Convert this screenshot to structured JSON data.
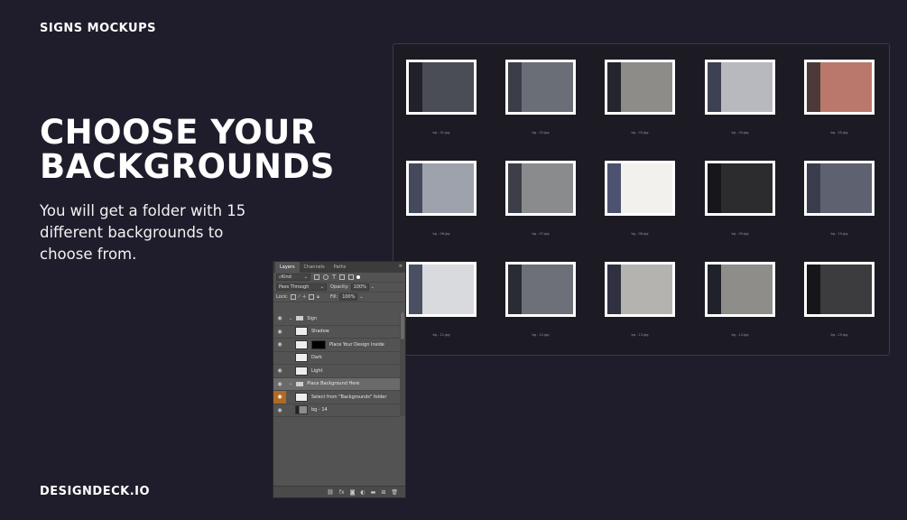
{
  "brand_top": "SIGNS MOCKUPS",
  "headline_line1": "CHOOSE YOUR",
  "headline_line2": "BACKGROUNDS",
  "subtext": "You will get a folder with 15 different backgrounds to choose from.",
  "brand_bottom": "DESIGNDECK.IO",
  "folder": {
    "files": [
      {
        "name": "bg - 01.jpg",
        "color": "#4a4d55",
        "stripe": "#20212b"
      },
      {
        "name": "bg - 02.jpg",
        "color": "#6a6e76",
        "stripe": "#3b3e48"
      },
      {
        "name": "bg - 03.jpg",
        "color": "#8e8c88",
        "stripe": "#25252d"
      },
      {
        "name": "bg - 04.jpg",
        "color": "#b7b9bf",
        "stripe": "#3d4152"
      },
      {
        "name": "bg - 05.jpg",
        "color": "#b9786b",
        "stripe": "#4c3a3a"
      },
      {
        "name": "bg - 06.jpg",
        "color": "#9ea2ac",
        "stripe": "#444a5c"
      },
      {
        "name": "bg - 07.jpg",
        "color": "#8a8b8c",
        "stripe": "#3d3f48"
      },
      {
        "name": "bg - 08.jpg",
        "color": "#f3f1ee",
        "stripe": "#4d5270"
      },
      {
        "name": "bg - 09.jpg",
        "color": "#2c2c2e",
        "stripe": "#16161c"
      },
      {
        "name": "bg - 10.jpg",
        "color": "#5e6170",
        "stripe": "#3a3d4d"
      },
      {
        "name": "bg - 11.jpg",
        "color": "#d9dadd",
        "stripe": "#4a5062"
      },
      {
        "name": "bg - 12.jpg",
        "color": "#6d7079",
        "stripe": "#2a2c34"
      },
      {
        "name": "bg - 13.jpg",
        "color": "#b5b3af",
        "stripe": "#2f3140"
      },
      {
        "name": "bg - 14.jpg",
        "color": "#8f8d8a",
        "stripe": "#20222b"
      },
      {
        "name": "bg - 15.jpg",
        "color": "#3c3c3e",
        "stripe": "#16161a"
      }
    ]
  },
  "photoshop": {
    "tabs": [
      "Layers",
      "Channels",
      "Paths"
    ],
    "filter_kind": "Kind",
    "blend_mode": "Pass Through",
    "opacity_label": "Opacity:",
    "opacity_value": "100%",
    "lock_label": "Lock:",
    "fill_label": "Fill:",
    "fill_value": "100%",
    "layers": [
      {
        "name": "Sign",
        "type": "group",
        "visible": true
      },
      {
        "name": "Shadow",
        "type": "layer",
        "visible": true
      },
      {
        "name": "Place Your Design Inside",
        "type": "smart",
        "visible": true
      },
      {
        "name": "Dark",
        "type": "layer",
        "visible": false
      },
      {
        "name": "Light",
        "type": "layer",
        "visible": true
      },
      {
        "name": "Place Background Here",
        "type": "group",
        "visible": true,
        "selected": true
      },
      {
        "name": "Select from \"Backgrounds\" folder",
        "type": "layer",
        "visible": true,
        "orange": true
      },
      {
        "name": "bg - 14",
        "type": "layer",
        "visible": true
      }
    ],
    "bottom_icons": [
      "link-icon",
      "fx-icon",
      "mask-icon",
      "adjustment-icon",
      "folder-icon",
      "new-layer-icon",
      "trash-icon"
    ],
    "bottom_fx": "fx"
  }
}
